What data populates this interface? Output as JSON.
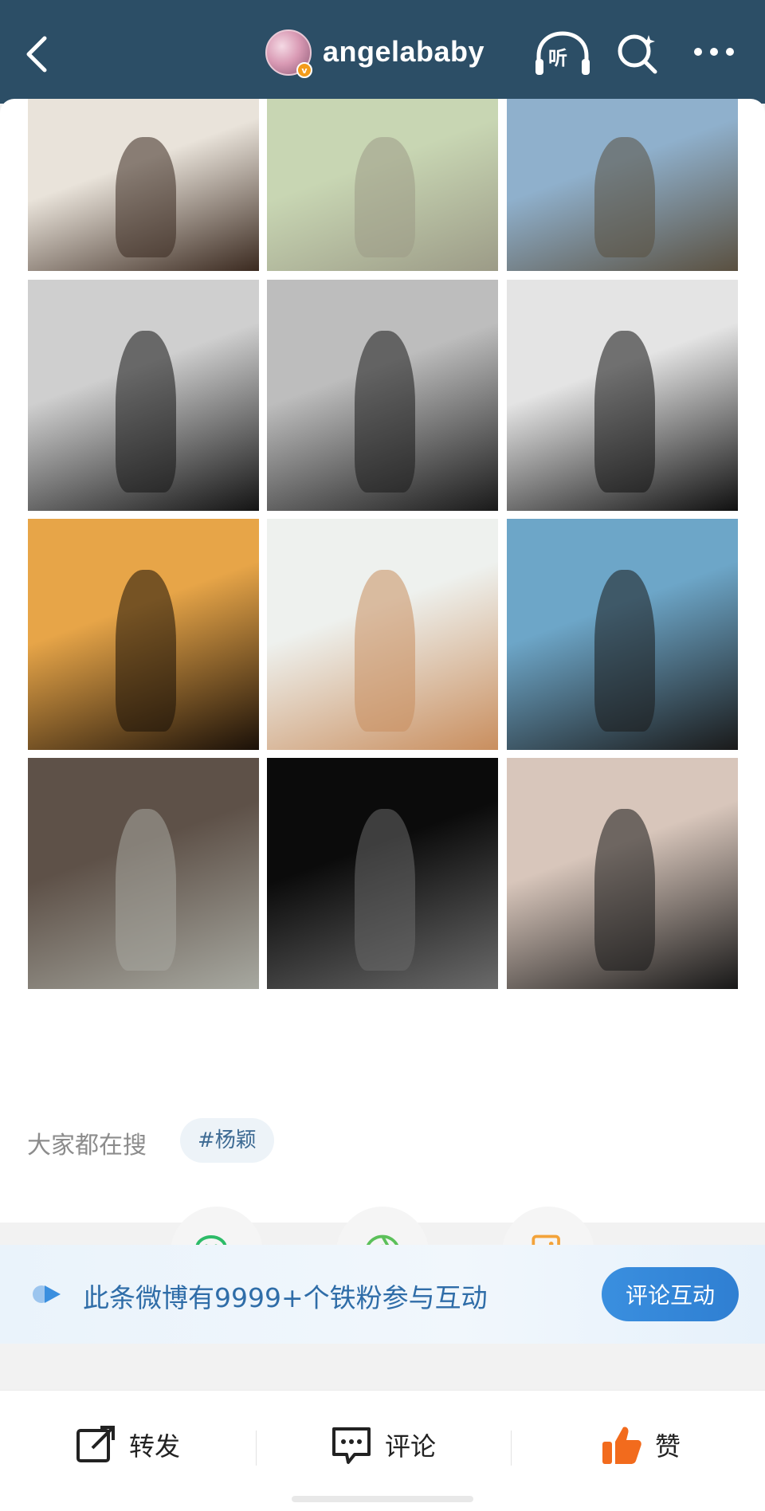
{
  "header": {
    "username": "angelababy",
    "verified_badge": "v",
    "listen_label": "听",
    "icons": [
      "back-arrow-icon",
      "headphones-icon",
      "search-icon",
      "more-icon"
    ]
  },
  "photos": [
    {
      "name": "photo-cafe-interior",
      "colors": [
        "#e9e3da",
        "#3b2a20"
      ]
    },
    {
      "name": "photo-park-walk",
      "colors": [
        "#c8d6b3",
        "#9c9b87"
      ]
    },
    {
      "name": "photo-table-window",
      "colors": [
        "#8fb0cc",
        "#5a5040"
      ]
    },
    {
      "name": "photo-bw-portrait-chair",
      "colors": [
        "#cfcfcf",
        "#141414"
      ]
    },
    {
      "name": "photo-bw-reading",
      "colors": [
        "#bdbdbd",
        "#1a1a1a"
      ]
    },
    {
      "name": "photo-bw-graffiti",
      "colors": [
        "#e4e4e4",
        "#101010"
      ]
    },
    {
      "name": "photo-yellow-wall-gown",
      "colors": [
        "#e7a548",
        "#1a1008"
      ]
    },
    {
      "name": "photo-soft-portrait",
      "colors": [
        "#eef1ee",
        "#c98e5e"
      ]
    },
    {
      "name": "photo-river-hat",
      "colors": [
        "#6da6c8",
        "#1a1a1a"
      ]
    },
    {
      "name": "photo-staircase-gown",
      "colors": [
        "#5e5148",
        "#a7a8a0"
      ]
    },
    {
      "name": "photo-stage-spotlight",
      "colors": [
        "#0b0b0b",
        "#6a6a6a"
      ]
    },
    {
      "name": "photo-closeup-eyes",
      "colors": [
        "#d8c6bb",
        "#181818"
      ]
    }
  ],
  "trending": {
    "label": "大家都在搜",
    "tag": "#杨颖"
  },
  "share": {
    "icons": [
      "wechat-icon",
      "moments-icon",
      "save-image-icon"
    ],
    "colors": {
      "wechat": "#2dbb68",
      "moments": "#5cc05a",
      "save": "#f3a33a"
    }
  },
  "fans_banner": {
    "text": "此条微博有9999+个铁粉参与互动",
    "button": "评论互动"
  },
  "bottom_bar": {
    "repost": "转发",
    "comment": "评论",
    "like": "赞",
    "like_color": "#f26b1d"
  }
}
